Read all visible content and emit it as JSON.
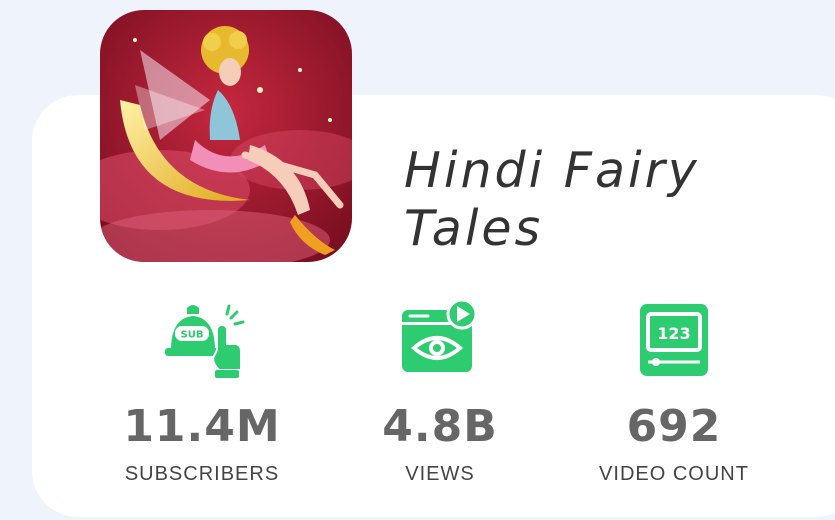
{
  "channel": {
    "name": "Hindi Fairy Tales"
  },
  "stats": [
    {
      "value": "11.4M",
      "label": "SUBSCRIBERS",
      "icon": "subscribe-bell-icon"
    },
    {
      "value": "4.8B",
      "label": "VIEWS",
      "icon": "video-views-eye-icon"
    },
    {
      "value": "692",
      "label": "VIDEO COUNT",
      "icon": "video-count-icon"
    }
  ],
  "colors": {
    "accent": "#2ecc71",
    "background": "#eff3fb",
    "card": "#ffffff",
    "value_text": "#666666"
  }
}
